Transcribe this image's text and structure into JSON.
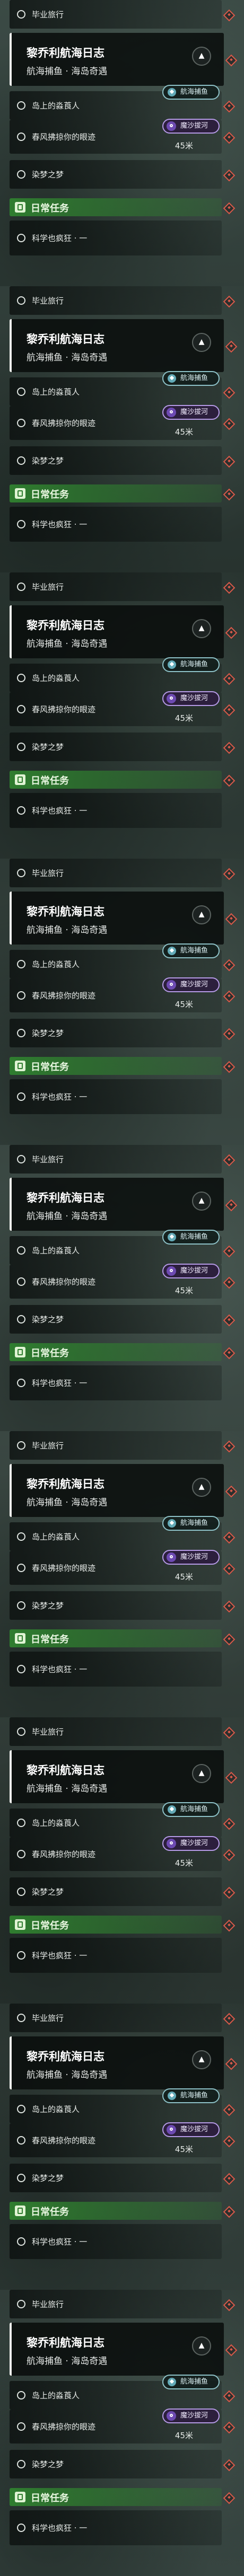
{
  "tracker": {
    "achievement_label": "毕业旅行",
    "quest": {
      "title": "黎乔利航海日志",
      "subtitle": "航海捕鱼 · 海岛奇遇",
      "collapse_icon": "chevron-up-icon"
    },
    "objectives": [
      {
        "label": "岛上的淼莨人",
        "tag": "航海捕鱼"
      },
      {
        "label": "春风拂掠你的眼迹",
        "tag": "魔沙拔河",
        "distance": "45米"
      },
      {
        "label": "染梦之梦"
      }
    ],
    "daily_label": "日常任务",
    "daily_item": "科学也疯狂 · 一",
    "colors": {
      "accent_red": "#d85a4a",
      "daily_green": "#2f7d2f",
      "tag_teal": "#8ec2c8",
      "tag_purple": "#b59ae6"
    }
  }
}
